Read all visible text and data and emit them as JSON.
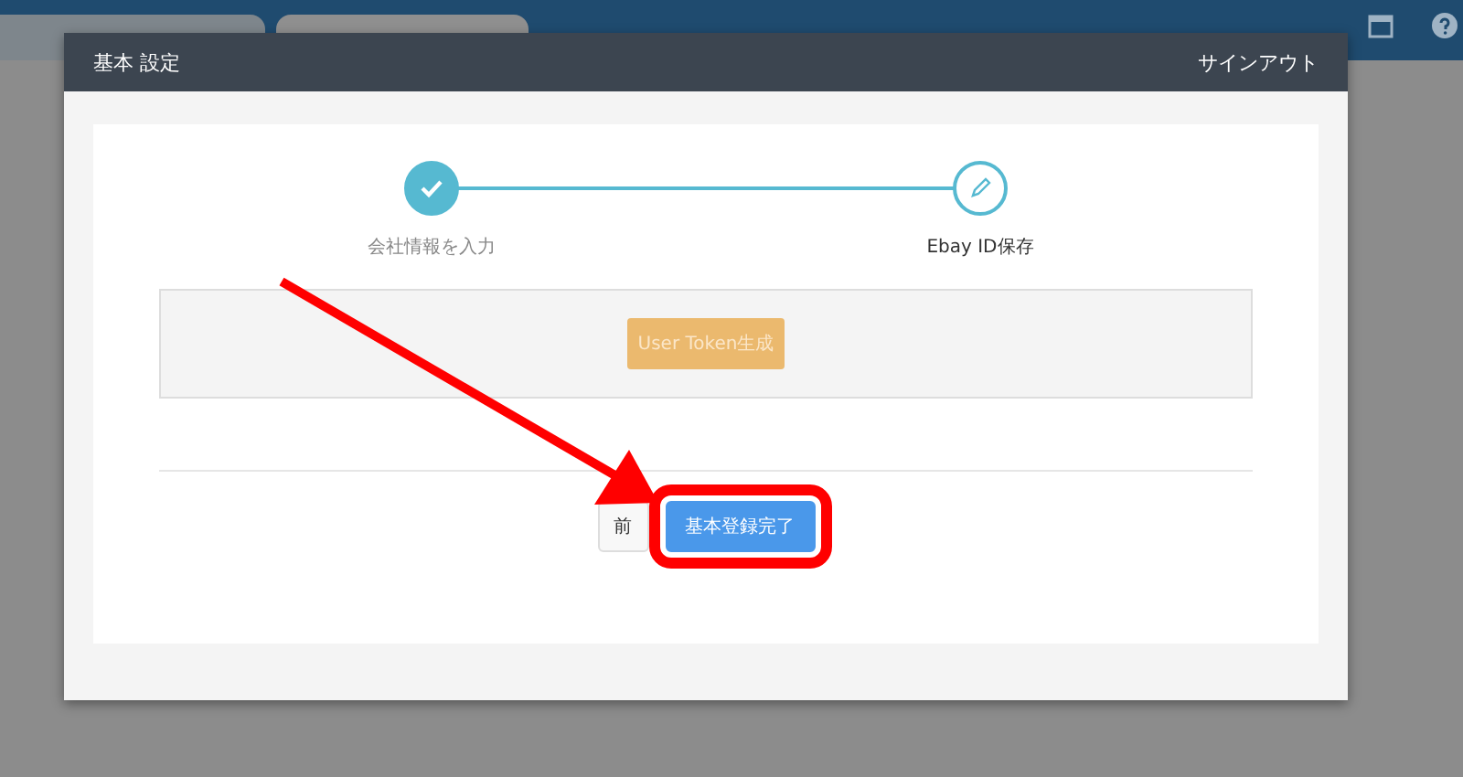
{
  "background_tabs": [
    {
      "selected": false
    },
    {
      "selected": true
    }
  ],
  "modal": {
    "title": "基本 設定",
    "sign_out": "サインアウト",
    "steps": [
      {
        "label": "会社情報を入力",
        "completed": true
      },
      {
        "label": "Ebay ID保存",
        "completed": false
      }
    ],
    "token_button": {
      "label": "User Token生成",
      "disabled": true
    },
    "buttons": [
      {
        "label": "前",
        "kind": "default"
      },
      {
        "label": "基本登録完了",
        "kind": "primary",
        "highlighted": true
      }
    ]
  }
}
